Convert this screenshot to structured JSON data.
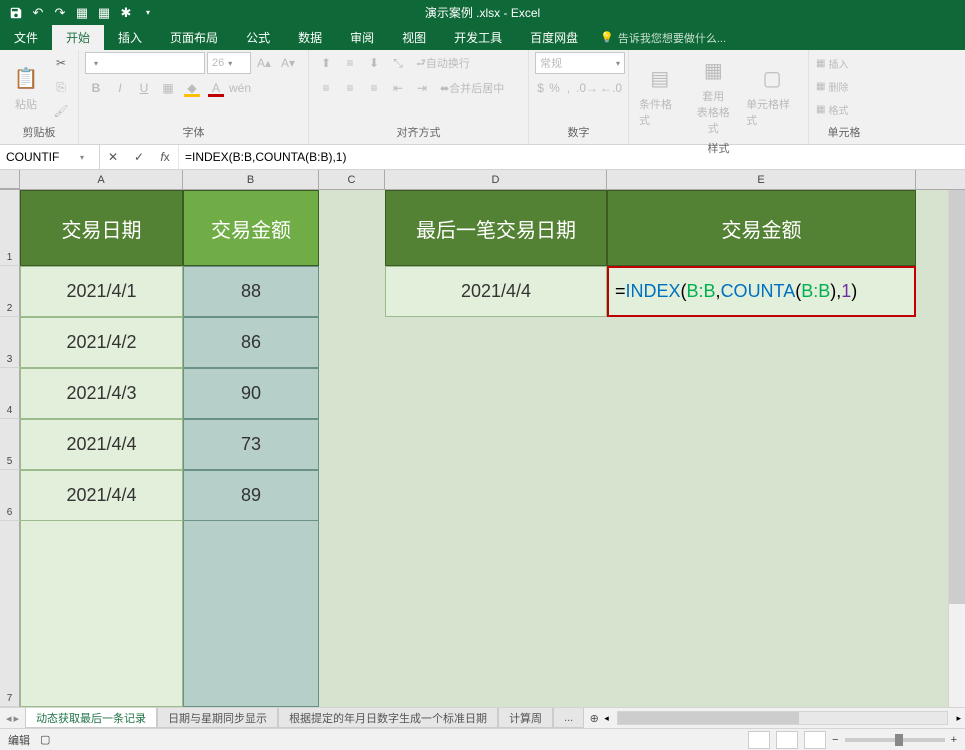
{
  "title": "演示案例 .xlsx - Excel",
  "tabs": {
    "file": "文件",
    "home": "开始",
    "insert": "插入",
    "layout": "页面布局",
    "formulas": "公式",
    "data": "数据",
    "review": "审阅",
    "view": "视图",
    "dev": "开发工具",
    "baidu": "百度网盘"
  },
  "tell_me": "告诉我您想要做什么...",
  "ribbon": {
    "clipboard": {
      "paste": "粘贴",
      "label": "剪贴板"
    },
    "font": {
      "size": "26",
      "label": "字体"
    },
    "alignment": {
      "wrap": "自动换行",
      "merge": "合并后居中",
      "label": "对齐方式"
    },
    "number": {
      "format": "常规",
      "label": "数字"
    },
    "styles": {
      "cond": "条件格式",
      "table": "套用\n表格格式",
      "cell": "单元格样式",
      "label": "样式"
    },
    "cells": {
      "insert": "插入",
      "delete": "删除",
      "format": "格式",
      "label": "单元格"
    }
  },
  "name_box": "COUNTIF",
  "formula_bar": "=INDEX(B:B,COUNTA(B:B),1)",
  "columns": [
    "A",
    "B",
    "C",
    "D",
    "E"
  ],
  "sheet": {
    "A1": "交易日期",
    "B1": "交易金额",
    "D1": "最后一笔交易日期",
    "E1": "交易金额",
    "A2": "2021/4/1",
    "B2": "88",
    "A3": "2021/4/2",
    "B3": "86",
    "A4": "2021/4/3",
    "B4": "90",
    "A5": "2021/4/4",
    "B5": "73",
    "A6": "2021/4/4",
    "B6": "89",
    "D2": "2021/4/4",
    "E2_formula": {
      "pre": "=",
      "fn1": "INDEX",
      "p1": "(",
      "r1": "B:B",
      "c1": ", ",
      "fn2": "COUNTA",
      "p2": "(",
      "r2": "B:B",
      "p3": ")",
      "c2": ", ",
      "n": "1",
      "p4": ")"
    }
  },
  "sheet_tabs": {
    "active": "动态获取最后一条记录",
    "t2": "日期与星期同步显示",
    "t3": "根据提定的年月日数字生成一个标准日期",
    "t4": "计算周"
  },
  "status": {
    "edit": "编辑",
    "zoom": "100%"
  }
}
